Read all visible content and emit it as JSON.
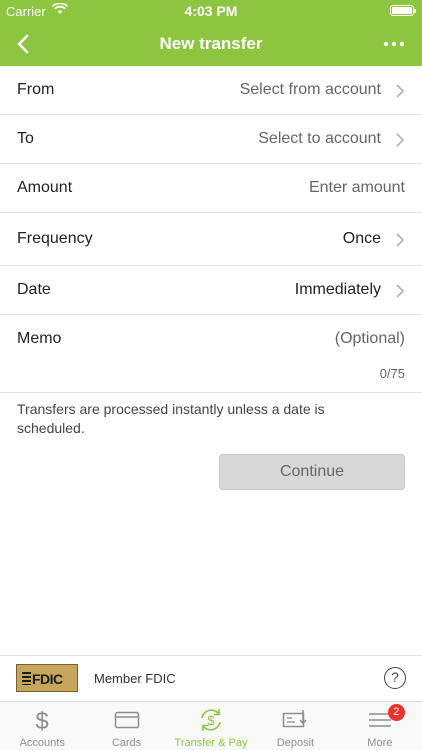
{
  "status_bar": {
    "carrier": "Carrier",
    "time": "4:03 PM"
  },
  "header": {
    "title": "New transfer",
    "accent": "#8cc540"
  },
  "form": {
    "rows": [
      {
        "label": "From",
        "value": "Select from account"
      },
      {
        "label": "To",
        "value": "Select to account"
      },
      {
        "label": "Amount",
        "placeholder": "Enter amount"
      },
      {
        "label": "Frequency",
        "value": "Once"
      },
      {
        "label": "Date",
        "value": "Immediately"
      },
      {
        "label": "Memo",
        "placeholder": "(Optional)",
        "counter": "0/75"
      }
    ]
  },
  "info_text": "Transfers are processed instantly unless a date is scheduled.",
  "continue_label": "Continue",
  "fdic": {
    "logo_text": "FDIC",
    "member_text": "Member FDIC",
    "help_label": "?"
  },
  "tabs": [
    {
      "label": "Accounts",
      "icon": "dollar-icon"
    },
    {
      "label": "Cards",
      "icon": "card-icon"
    },
    {
      "label": "Transfer & Pay",
      "icon": "transfer-icon",
      "active": true
    },
    {
      "label": "Deposit",
      "icon": "check-deposit-icon"
    },
    {
      "label": "More",
      "icon": "menu-icon",
      "badge": "2"
    }
  ]
}
